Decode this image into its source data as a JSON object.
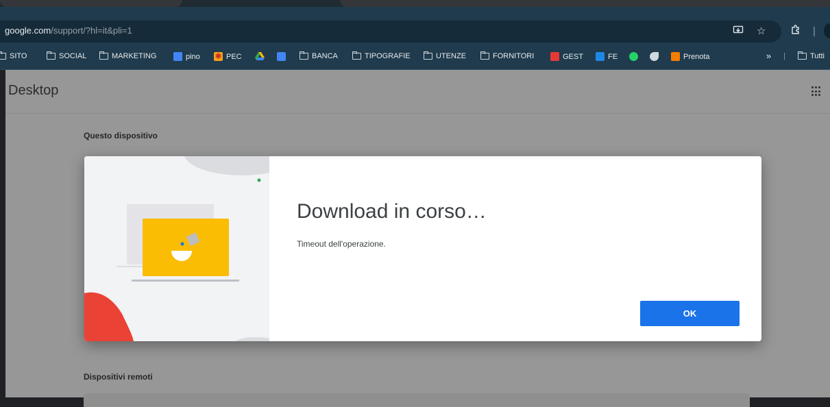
{
  "browser": {
    "url_host": "google.com",
    "url_path": "/support/?hl=it&pli=1",
    "bookmarks": [
      {
        "label": "SITO",
        "type": "folder"
      },
      {
        "label": "SOCIAL",
        "type": "folder"
      },
      {
        "label": "MARKETING",
        "type": "folder"
      },
      {
        "label": "pino",
        "type": "docs-icon"
      },
      {
        "label": "PEC",
        "type": "pec-icon"
      },
      {
        "label": "",
        "type": "drive-icon"
      },
      {
        "label": "",
        "type": "docs-icon"
      },
      {
        "label": "BANCA",
        "type": "folder"
      },
      {
        "label": "TIPOGRAFIE",
        "type": "folder"
      },
      {
        "label": "UTENZE",
        "type": "folder"
      },
      {
        "label": "FORNITORI",
        "type": "folder"
      },
      {
        "label": "GEST",
        "type": "gest-icon"
      },
      {
        "label": "FE",
        "type": "fe-icon"
      },
      {
        "label": "",
        "type": "whatsapp-icon"
      },
      {
        "label": "",
        "type": "bird-icon"
      },
      {
        "label": "Prenota",
        "type": "prenota-icon"
      }
    ],
    "overflow_label": "»",
    "other_bookmarks": "Tutti"
  },
  "app": {
    "title": "Desktop",
    "section_this_device": "Questo dispositivo",
    "section_remote": "Dispositivi remoti"
  },
  "dialog": {
    "title": "Download in corso…",
    "message": "Timeout dell'operazione.",
    "ok_label": "OK"
  },
  "colors": {
    "accent": "#1a73e8",
    "toolbar": "#1f3b4d",
    "overlay": "#979797",
    "illustration_yellow": "#fbbc04",
    "illustration_red": "#ea4335",
    "illustration_green": "#34a853"
  }
}
